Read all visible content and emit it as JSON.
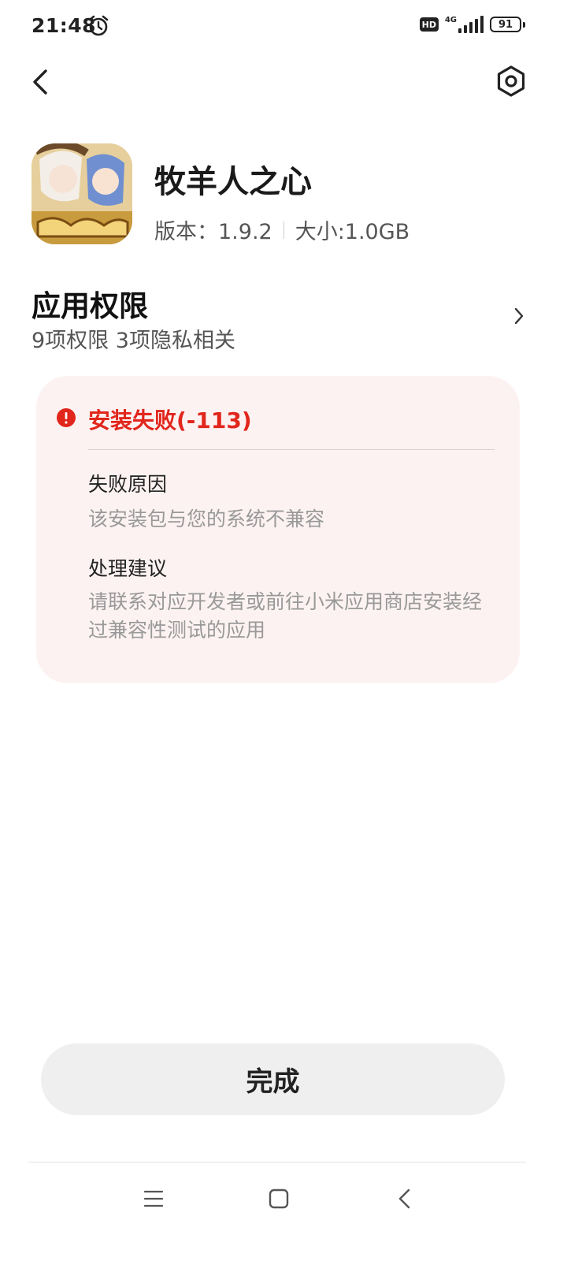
{
  "status_bar": {
    "time": "21:48",
    "hd_label": "HD",
    "network_label": "4G",
    "battery_level": "91",
    "icons": [
      "alarm-icon",
      "signal-icon",
      "battery-icon"
    ]
  },
  "nav": {
    "back_icon": "back-icon",
    "settings_icon": "settings-icon"
  },
  "app": {
    "name": "牧羊人之心",
    "version_text": "版本：1.9.2",
    "size_text": "大小:1.0GB",
    "icon": "app-icon"
  },
  "permissions": {
    "title": "应用权限",
    "summary": "9项权限 3项隐私相关"
  },
  "error": {
    "title": "安装失败(-113)",
    "reason_heading": "失败原因",
    "reason_text": "该安装包与您的系统不兼容",
    "advice_heading": "处理建议",
    "advice_text": "请联系对应开发者或前往小米应用商店安装经过兼容性测试的应用",
    "accent_color": "#e1261c",
    "card_color": "#fdf2f2"
  },
  "actions": {
    "done_label": "完成"
  },
  "navigation_bar": {
    "icons": [
      "menu-icon",
      "home-icon",
      "back-icon"
    ]
  }
}
